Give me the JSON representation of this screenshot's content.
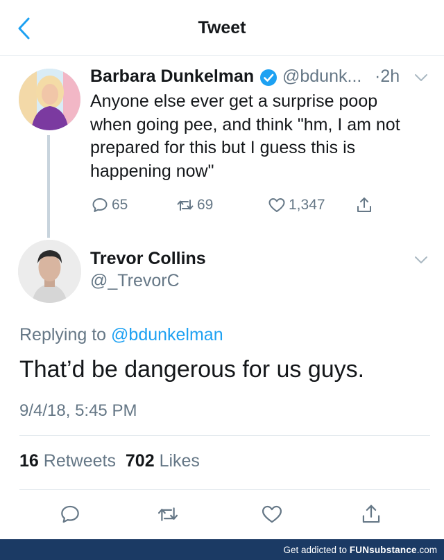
{
  "header": {
    "title": "Tweet"
  },
  "parent_tweet": {
    "author_name": "Barbara Dunkelman",
    "handle": "@bdunk...",
    "time": "·2h",
    "text": "Anyone else ever get a surprise poop when going pee, and think \"hm, I am not prepared for this but I guess this is happening now\"",
    "replies": "65",
    "retweets": "69",
    "likes": "1,347"
  },
  "main_tweet": {
    "author_name": "Trevor Collins",
    "handle": "@_TrevorC",
    "replying_prefix": "Replying to",
    "replying_handle": "@bdunkelman",
    "text": "That’d be dangerous for us guys.",
    "timestamp": "9/4/18, 5:45 PM",
    "retweet_count": "16",
    "retweet_label": "Retweets",
    "like_count": "702",
    "like_label": "Likes"
  },
  "icons": {
    "back": "chevron-left-icon",
    "verified": "verified-badge-icon",
    "reply": "reply-icon",
    "retweet": "retweet-icon",
    "like": "heart-icon",
    "share": "share-icon"
  },
  "colors": {
    "accent": "#1da1f2",
    "secondary_text": "#657786",
    "footer_bg": "#1b3a64"
  },
  "footer": {
    "prefix": "Get addicted to",
    "brand": "FUNsubstance",
    "suffix": ".com"
  }
}
